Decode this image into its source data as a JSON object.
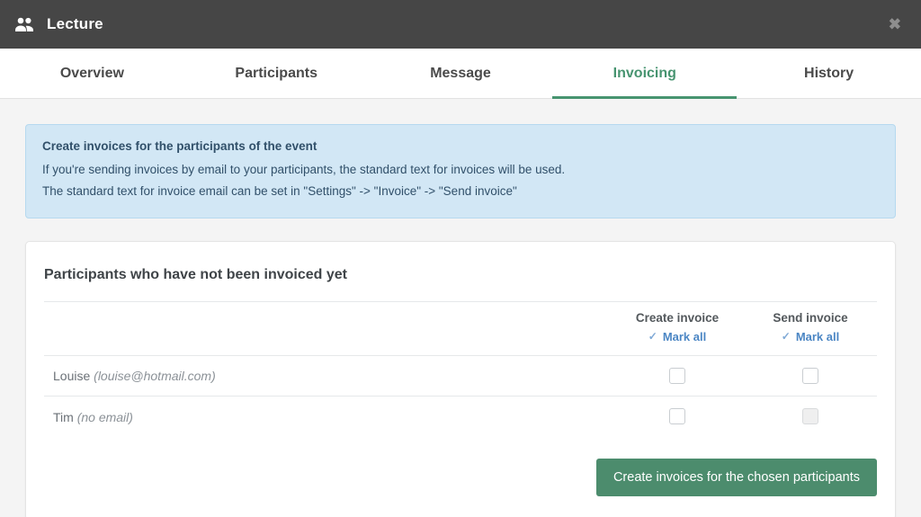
{
  "window": {
    "title": "Lecture",
    "icon": "users-icon",
    "close_label": "✖"
  },
  "tabs": [
    {
      "label": "Overview",
      "active": false
    },
    {
      "label": "Participants",
      "active": false
    },
    {
      "label": "Message",
      "active": false
    },
    {
      "label": "Invoicing",
      "active": true
    },
    {
      "label": "History",
      "active": false
    }
  ],
  "alert": {
    "title": "Create invoices for the participants of the event",
    "line1": "If you're sending invoices by email to your participants, the standard text for invoices will be used.",
    "line2": "The standard text for invoice email can be set in \"Settings\" -> \"Invoice\" -> \"Send invoice\""
  },
  "card": {
    "title": "Participants who have not been invoiced yet",
    "columns": {
      "name": "",
      "create_invoice": "Create invoice",
      "send_invoice": "Send invoice",
      "mark_all": "Mark all",
      "mark_all_icon": "✓"
    },
    "rows": [
      {
        "name": "Louise",
        "email": "(louise@hotmail.com)",
        "create_checked": false,
        "create_disabled": false,
        "send_checked": false,
        "send_disabled": false
      },
      {
        "name": "Tim",
        "email": "(no email)",
        "create_checked": false,
        "create_disabled": false,
        "send_checked": false,
        "send_disabled": true
      }
    ],
    "submit_label": "Create invoices for the chosen participants"
  },
  "colors": {
    "titlebar": "#464646",
    "accent_green": "#479470",
    "button_green": "#4c8c6d",
    "link_blue": "#4b86c4",
    "alert_bg": "#d2e7f5",
    "alert_border": "#b6d9ef",
    "page_bg": "#f4f4f4"
  }
}
